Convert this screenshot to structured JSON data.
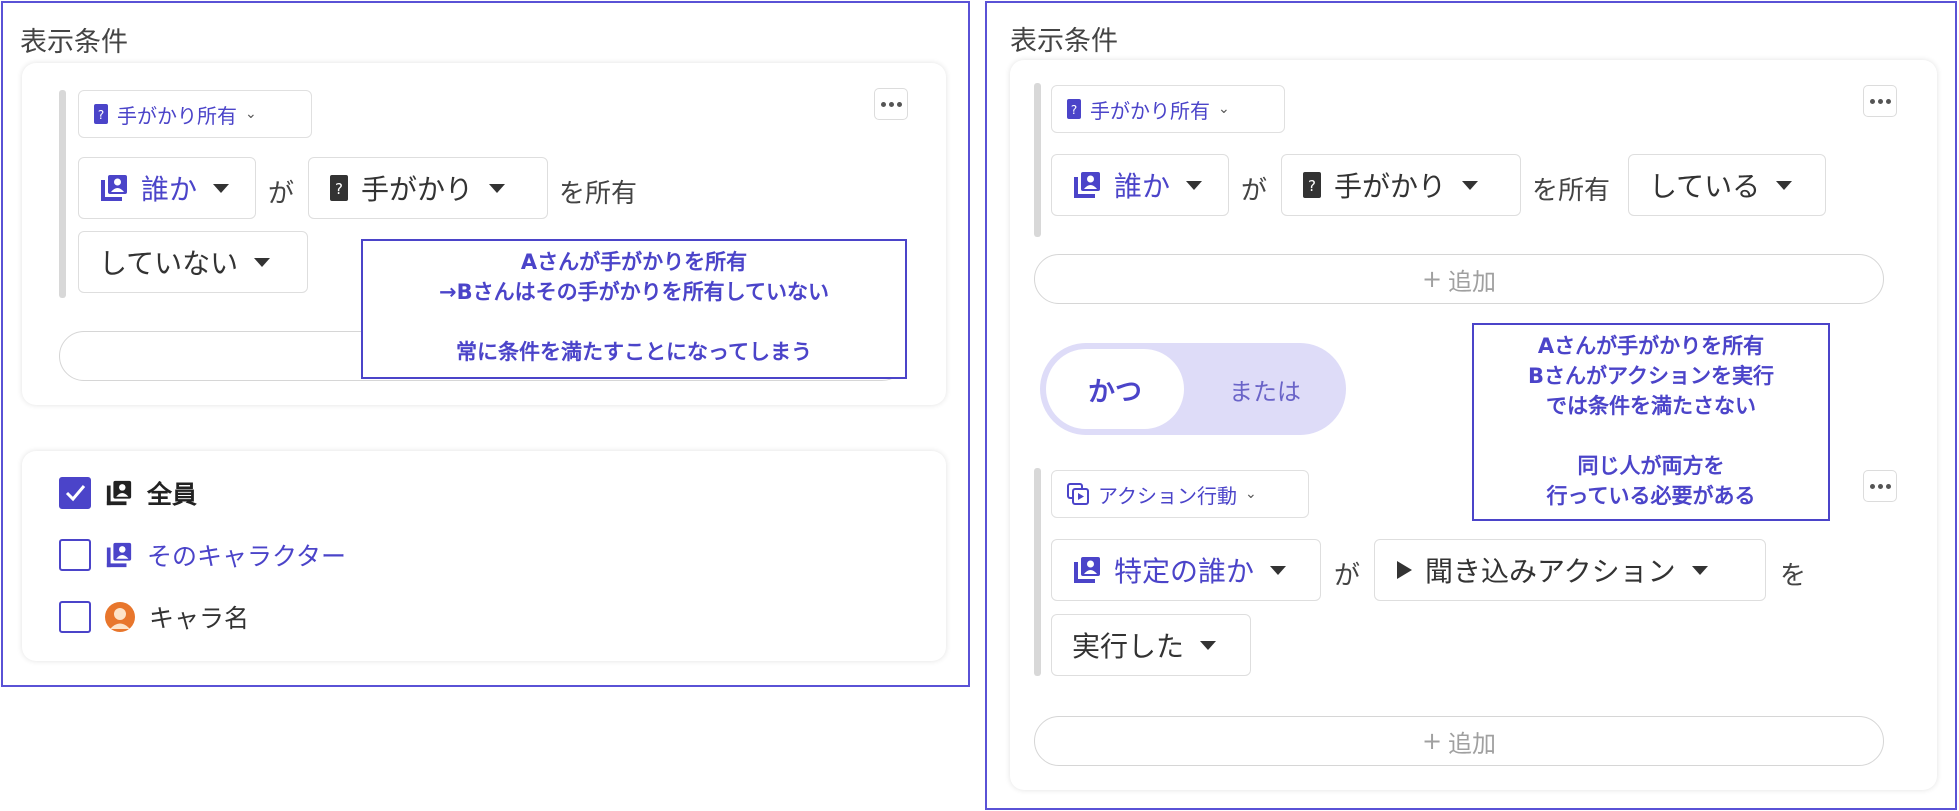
{
  "colors": {
    "accent": "#4b44c9",
    "frame": "#5a52d6",
    "toggle_bg": "#dedcf8",
    "avatar": "#e8762c"
  },
  "left_panel": {
    "title": "表示条件",
    "condition": {
      "type_chip": {
        "icon": "clue-card-icon",
        "label": "手がかり所有"
      },
      "subject_dropdown": {
        "icon": "person-card-icon",
        "label": "誰か"
      },
      "particle_ga": "が",
      "object_dropdown": {
        "icon": "clue-card-icon",
        "label": "手がかり"
      },
      "verb": "を所有",
      "state_dropdown": {
        "label": "していない"
      }
    },
    "note": [
      "Aさんが手がかりを所有",
      "→Bさんはその手がかりを所有していない",
      "",
      "常に条件を満たすことになってしまう"
    ],
    "targets": [
      {
        "label": "全員",
        "checked": true,
        "icon": "person-card-icon"
      },
      {
        "label": "そのキャラクター",
        "checked": false,
        "icon": "person-card-icon"
      },
      {
        "label": "キャラ名",
        "checked": false,
        "icon": "avatar-icon"
      }
    ]
  },
  "right_panel": {
    "title": "表示条件",
    "condition1": {
      "type_chip": {
        "icon": "clue-card-icon",
        "label": "手がかり所有"
      },
      "subject_dropdown": {
        "icon": "person-card-icon",
        "label": "誰か"
      },
      "particle_ga": "が",
      "object_dropdown": {
        "icon": "clue-card-icon",
        "label": "手がかり"
      },
      "verb": "を所有",
      "state_dropdown": {
        "label": "している"
      }
    },
    "add_label": "追加",
    "add_plus": "+",
    "logic_toggle": {
      "and_label": "かつ",
      "or_label": "または",
      "selected": "かつ"
    },
    "note": [
      "Aさんが手がかりを所有",
      "Bさんがアクションを実行",
      "では条件を満たさない",
      "",
      "同じ人が両方を",
      "行っている必要がある"
    ],
    "condition2": {
      "type_chip": {
        "icon": "action-icon",
        "label": "アクション行動"
      },
      "subject_dropdown": {
        "icon": "person-card-icon",
        "label": "特定の誰か"
      },
      "particle_ga": "が",
      "action_dropdown": {
        "icon": "play-icon",
        "label": "聞き込みアクション"
      },
      "particle_wo": "を",
      "state_dropdown": {
        "label": "実行した"
      }
    },
    "add_label2": "追加"
  }
}
